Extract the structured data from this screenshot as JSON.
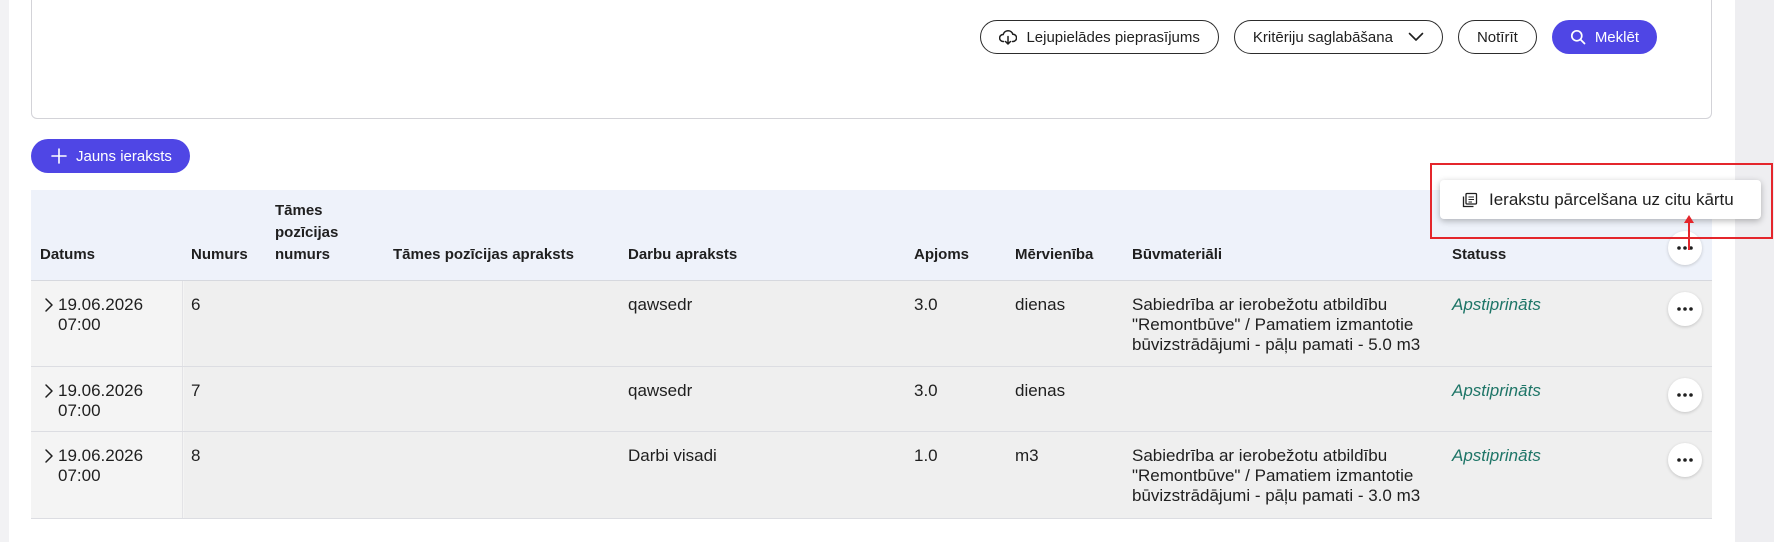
{
  "search": {
    "download_request_label": "Lejupielādes pieprasījums",
    "save_criteria_label": "Kritēriju saglabāšana",
    "clear_label": "Notīrīt",
    "search_label": "Meklēt"
  },
  "new_record_label": "Jauns ieraksts",
  "table": {
    "headers": {
      "date": "Datums",
      "number": "Numurs",
      "estimate_pos_number": [
        "Tāmes",
        "pozīcijas",
        "numurs"
      ],
      "estimate_pos_desc": "Tāmes pozīcijas apraksts",
      "work_desc": "Darbu apraksts",
      "volume": "Apjoms",
      "unit": "Mērvienība",
      "materials": "Būvmateriāli",
      "status": "Statuss"
    },
    "rows": [
      {
        "date": [
          "19.06.2026",
          "07:00"
        ],
        "number": "6",
        "estimate_pos_number": "",
        "estimate_pos_desc": "",
        "work_desc": "qawsedr",
        "volume": "3.0",
        "unit": "dienas",
        "materials": [
          "Sabiedrība ar ierobežotu atbildību",
          "\"Remontbūve\" / Pamatiem izmantotie",
          "būvizstrādājumi - pāļu pamati - 5.0 m3"
        ],
        "status": "Apstiprināts"
      },
      {
        "date": [
          "19.06.2026",
          "07:00"
        ],
        "number": "7",
        "estimate_pos_number": "",
        "estimate_pos_desc": "",
        "work_desc": "qawsedr",
        "volume": "3.0",
        "unit": "dienas",
        "materials": [
          "",
          "",
          ""
        ],
        "status": "Apstiprināts"
      },
      {
        "date": [
          "19.06.2026",
          "07:00"
        ],
        "number": "8",
        "estimate_pos_number": "",
        "estimate_pos_desc": "",
        "work_desc": "Darbi visadi",
        "volume": "1.0",
        "unit": "m3",
        "materials": [
          "Sabiedrība ar ierobežotu atbildību",
          "\"Remontbūve\" / Pamatiem izmantotie",
          "būvizstrādājumi - pāļu pamati - 3.0 m3"
        ],
        "status": "Apstiprināts"
      }
    ]
  },
  "context_menu": {
    "move_records_label": "Ierakstu pārcelšana uz citu kārtu"
  },
  "colors": {
    "primary": "#4f46e5",
    "status_approved": "#1e7567",
    "highlight": "#e4262c"
  }
}
